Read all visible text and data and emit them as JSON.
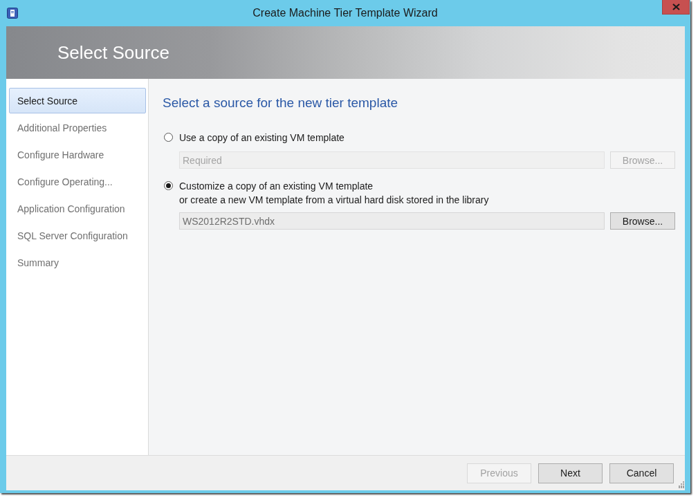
{
  "window": {
    "title": "Create Machine Tier Template Wizard"
  },
  "header": {
    "title": "Select Source"
  },
  "steps": [
    {
      "label": "Select Source",
      "selected": true
    },
    {
      "label": "Additional Properties",
      "selected": false
    },
    {
      "label": "Configure Hardware",
      "selected": false
    },
    {
      "label": "Configure Operating...",
      "selected": false
    },
    {
      "label": "Application Configuration",
      "selected": false
    },
    {
      "label": "SQL Server Configuration",
      "selected": false
    },
    {
      "label": "Summary",
      "selected": false
    }
  ],
  "page": {
    "heading": "Select a source for the new tier template",
    "options": [
      {
        "label": "Use a copy of an existing VM template",
        "selected": false,
        "field": {
          "placeholder": "Required",
          "disabled": true
        },
        "browse": {
          "label": "Browse...",
          "disabled": true
        }
      },
      {
        "label": "Customize a copy of an existing VM template",
        "description": "or create a new VM template from a virtual hard disk stored in the library",
        "selected": true,
        "field": {
          "value": "WS2012R2STD.vhdx",
          "disabled": false
        },
        "browse": {
          "label": "Browse...",
          "disabled": false
        }
      }
    ]
  },
  "buttons": [
    {
      "label": "Previous",
      "disabled": true
    },
    {
      "label": "Next",
      "disabled": false
    },
    {
      "label": "Cancel",
      "disabled": false
    }
  ]
}
